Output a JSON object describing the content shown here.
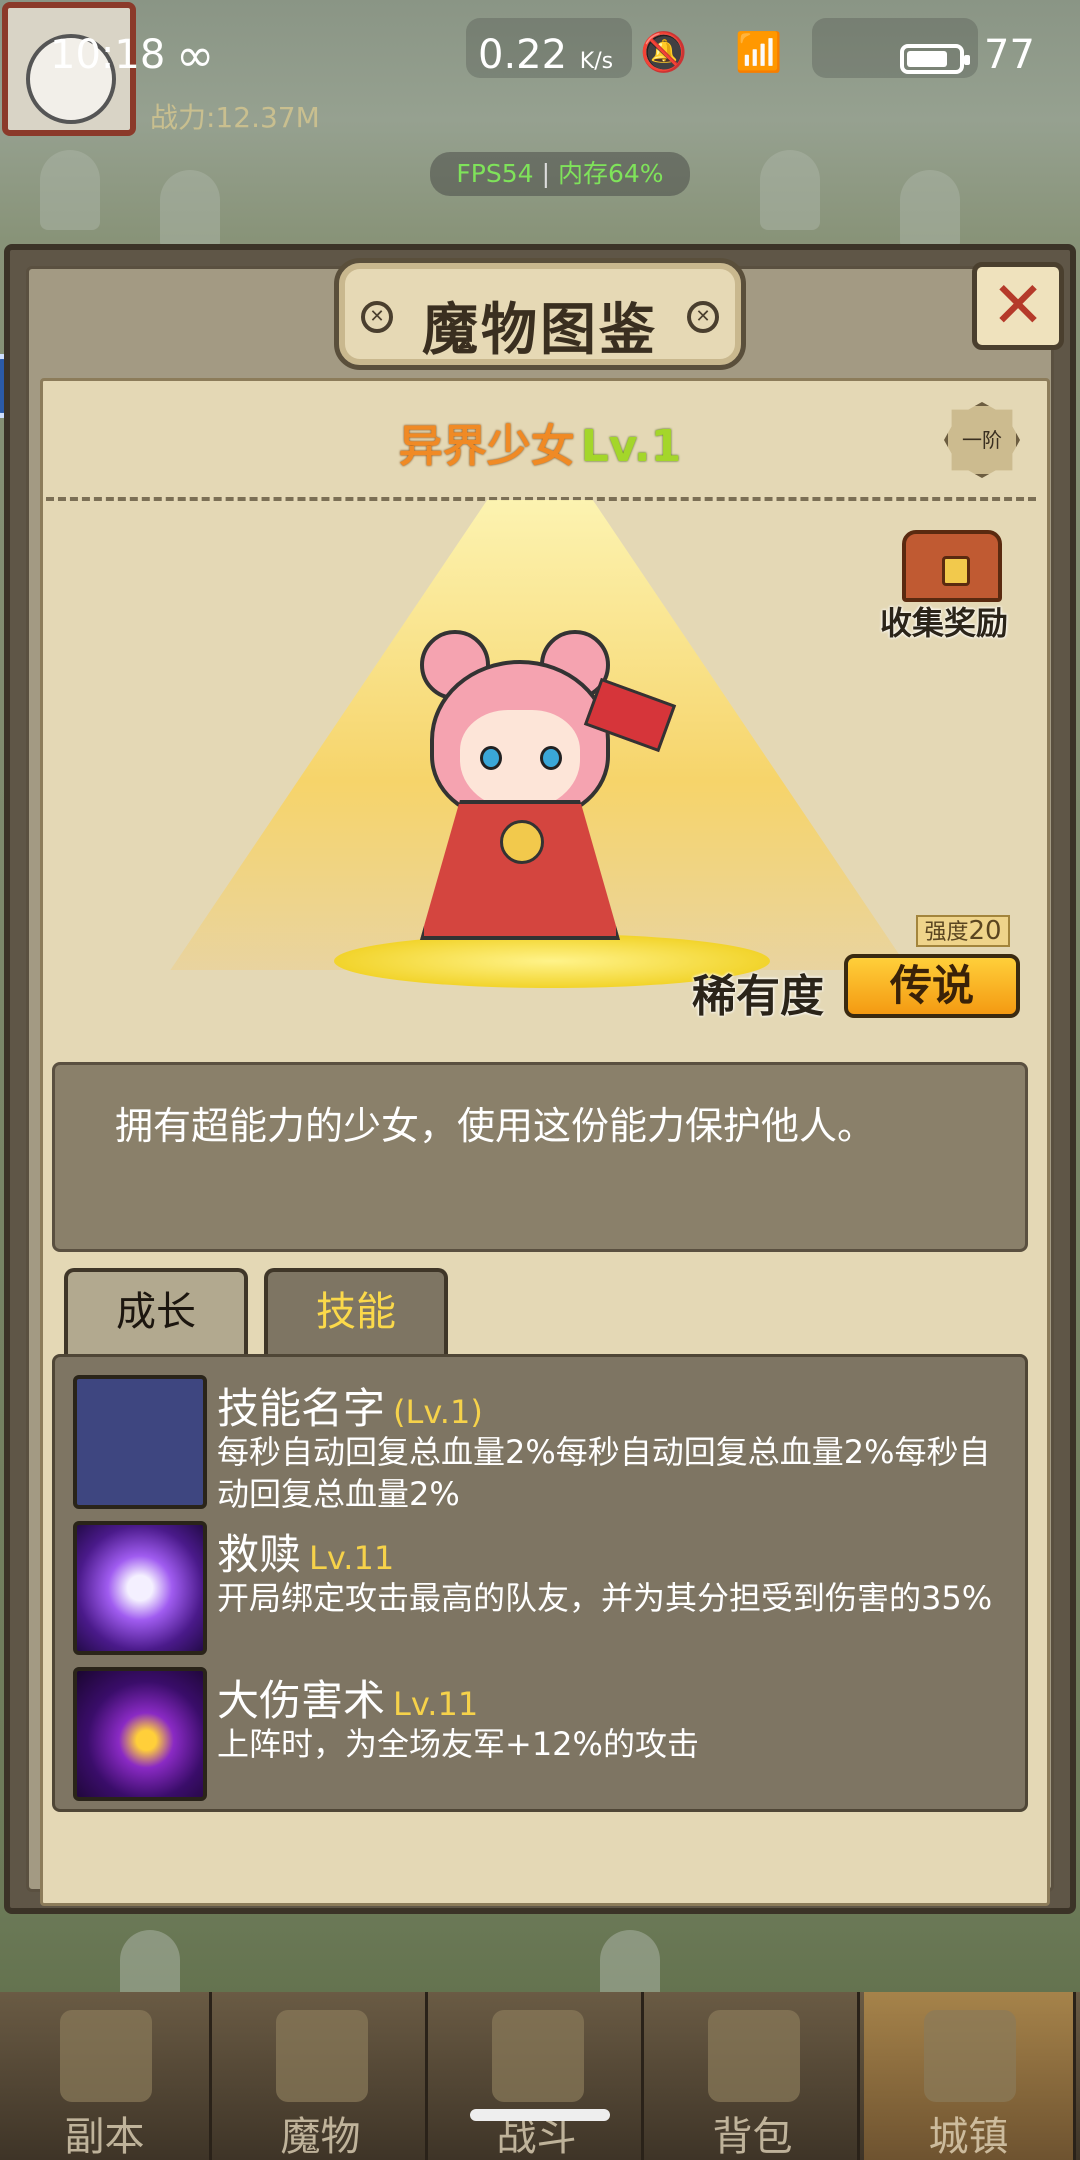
{
  "status_bar": {
    "time": "10:18",
    "infinity": "∞",
    "speed": "0.22",
    "speed_unit": "K/s",
    "icons": "🔕 📶",
    "battery": "77"
  },
  "hud": {
    "power": "战力:12.37M"
  },
  "fps": {
    "fps": "FPS54",
    "memory": "内存64%"
  },
  "dialog": {
    "title": "魔物图鉴",
    "close_label": "✕",
    "monster_name": "异界少女",
    "monster_level": "Lv.1",
    "rank": "一阶",
    "collect_reward_label": "收集奖励",
    "strength_label": "强度",
    "strength_value": "20",
    "rarity_label": "稀有度",
    "rarity_value": "传说",
    "description": "拥有超能力的少女，使用这份能力保护他人。",
    "tabs": [
      {
        "label": "成长"
      },
      {
        "label": "技能"
      }
    ],
    "skills": [
      {
        "name": "技能名字",
        "level": "(Lv.1)",
        "desc": "每秒自动回复总血量2%每秒自动回复总血量2%每秒自动回复总血量2%"
      },
      {
        "name": "救赎",
        "level": "Lv.11",
        "desc": "开局绑定攻击最高的队友，并为其分担受到伤害的35%"
      },
      {
        "name": "大伤害术",
        "level": "Lv.11",
        "desc": "上阵时，为全场友军+12%的攻击"
      }
    ]
  },
  "bottom_nav": [
    {
      "label": "副本"
    },
    {
      "label": "魔物"
    },
    {
      "label": "战斗"
    },
    {
      "label": "背包"
    },
    {
      "label": "城镇"
    }
  ],
  "colors": {
    "monster_name": "#f08a25",
    "level": "#a4d62a",
    "active_tab_text": "#fbd94a",
    "rarity_badge": "#f4a81a"
  }
}
